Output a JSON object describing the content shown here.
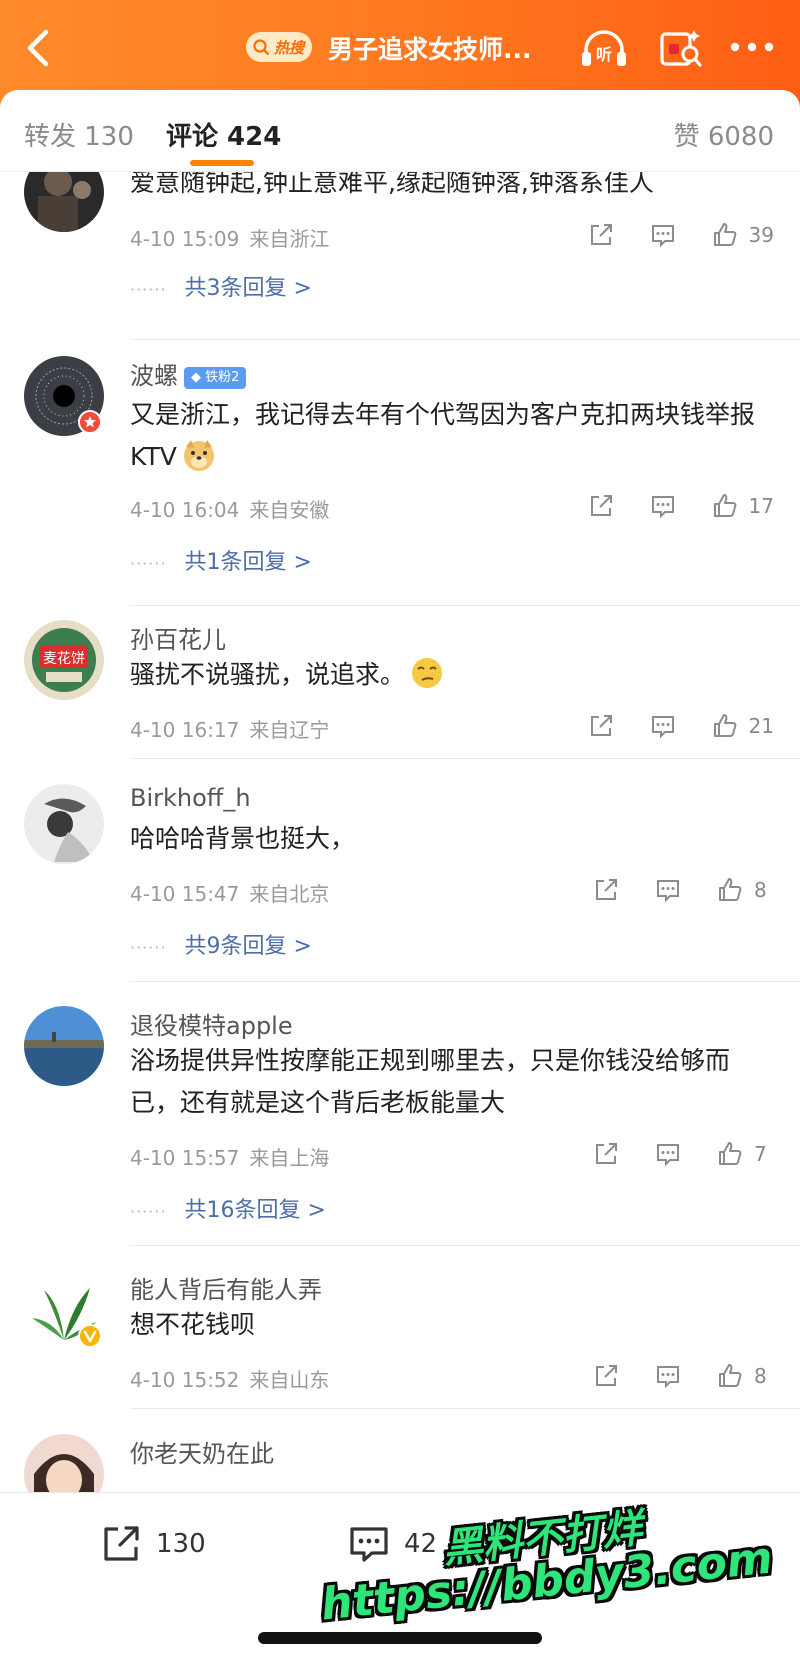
{
  "header": {
    "back_icon": "chevron-left-icon",
    "hot_label": "热搜",
    "title": "男子追求女技师...",
    "listen_label": "听",
    "background_gradient": [
      "#ff8a2a",
      "#ff5e14"
    ]
  },
  "tabs": {
    "repost": "转发 130",
    "comments": "评论 424",
    "likes": "赞 6080",
    "accent_color": "#ff8200"
  },
  "comments": [
    {
      "author": "",
      "content": "爱意随钟起,钟止意难平,缘起随钟落,钟落系佳人",
      "time": "4-10 15:09",
      "location": "来自浙江",
      "likes": "39",
      "replies": "共3条回复 >"
    },
    {
      "author": "波螺",
      "badge": "铁粉2",
      "content": "又是浙江，我记得去年有个代驾因为客户克扣两块钱举报KTV",
      "time": "4-10 16:04",
      "location": "来自安徽",
      "likes": "17",
      "replies": "共1条回复 >"
    },
    {
      "author": "孙百花儿",
      "content": "骚扰不说骚扰，说追求。",
      "time": "4-10 16:17",
      "location": "来自辽宁",
      "likes": "21"
    },
    {
      "author": "Birkhoff_h",
      "content": "哈哈哈背景也挺大，",
      "time": "4-10 15:47",
      "location": "来自北京",
      "likes": "8",
      "replies": "共9条回复 >"
    },
    {
      "author": "退役模特apple",
      "content": "浴场提供异性按摩能正规到哪里去，只是你钱没给够而已，还有就是这个背后老板能量大",
      "time": "4-10 15:57",
      "location": "来自上海",
      "likes": "7",
      "replies": "共16条回复 >"
    },
    {
      "author": "能人背后有能人弄",
      "content": "想不花钱呗",
      "time": "4-10 15:52",
      "location": "来自山东",
      "likes": "8"
    },
    {
      "author": "你老天奶在此"
    }
  ],
  "reply_dots": "······",
  "bottom_bar": {
    "repost_count": "130",
    "comment_count": "42"
  },
  "watermark": {
    "line1": "黑料不打烊",
    "line2": "https://bbdy3.com"
  }
}
